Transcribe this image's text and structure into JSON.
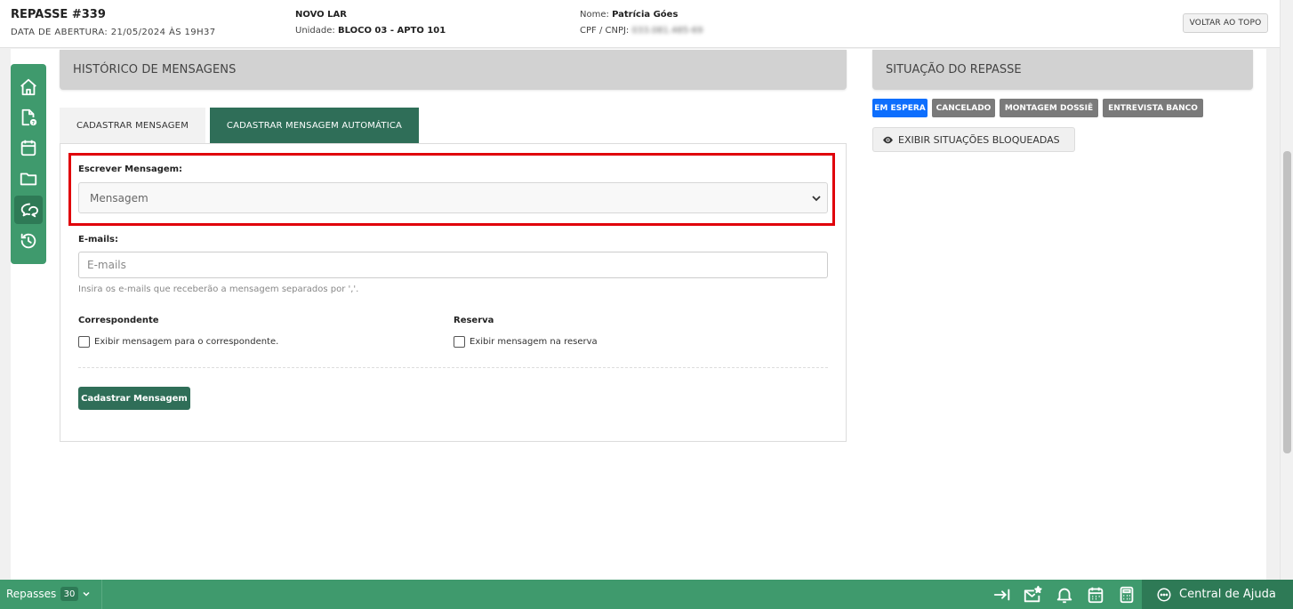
{
  "header": {
    "title": "REPASSE #339",
    "opening_label": "DATA DE ABERTURA: 21/05/2024 ÀS 19H37",
    "project": "NOVO LAR",
    "unit_label": "Unidade:",
    "unit_value": "BLOCO 03 - APTO 101",
    "name_label": "Nome:",
    "name_value": "Patrícia Góes",
    "cpf_label": "CPF / CNPJ:",
    "cpf_value": "033.081.485-69",
    "back_to_top": "VOLTAR AO TOPO"
  },
  "sidebar": {
    "items": [
      {
        "icon": "home-icon"
      },
      {
        "icon": "document-question-icon"
      },
      {
        "icon": "calendar-icon"
      },
      {
        "icon": "folder-icon"
      },
      {
        "icon": "chat-icon",
        "active": true
      },
      {
        "icon": "history-icon"
      }
    ]
  },
  "messages": {
    "section_title": "HISTÓRICO DE MENSAGENS",
    "tabs": [
      {
        "label": "CADASTRAR MENSAGEM",
        "active": false
      },
      {
        "label": "CADASTRAR MENSAGEM AUTOMÁTICA",
        "active": true
      }
    ],
    "write_label": "Escrever Mensagem:",
    "write_select_value": "Mensagem",
    "emails_label": "E-mails:",
    "emails_placeholder": "E-mails",
    "emails_help": "Insira os e-mails que receberão a mensagem separados por ','.",
    "correspondent_label": "Correspondente",
    "correspondent_checkbox": "Exibir mensagem para o correspondente.",
    "reserve_label": "Reserva",
    "reserve_checkbox": "Exibir mensagem na reserva",
    "submit_label": "Cadastrar Mensagem"
  },
  "status": {
    "section_title": "SITUAÇÃO DO REPASSE",
    "badges": [
      {
        "label": "EM ESPERA",
        "color": "#0d6efd"
      },
      {
        "label": "CANCELADO",
        "color": "#7a7a7a"
      },
      {
        "label": "MONTAGEM DOSSIÊ",
        "color": "#7a7a7a"
      },
      {
        "label": "ENTREVISTA BANCO",
        "color": "#7a7a7a"
      }
    ],
    "show_blocked": "EXIBIR SITUAÇÕES BLOQUEADAS"
  },
  "bottom_bar": {
    "repasses_label": "Repasses",
    "repasses_count": "30",
    "help_center": "Central de Ajuda",
    "icons": [
      "collapse-right-icon",
      "mail-star-icon",
      "bell-icon",
      "calendar-icon",
      "calculator-icon"
    ]
  },
  "colors": {
    "brand_green": "#3f9a6d",
    "dark_green": "#2f6e58",
    "highlight_red": "#e0000a"
  }
}
